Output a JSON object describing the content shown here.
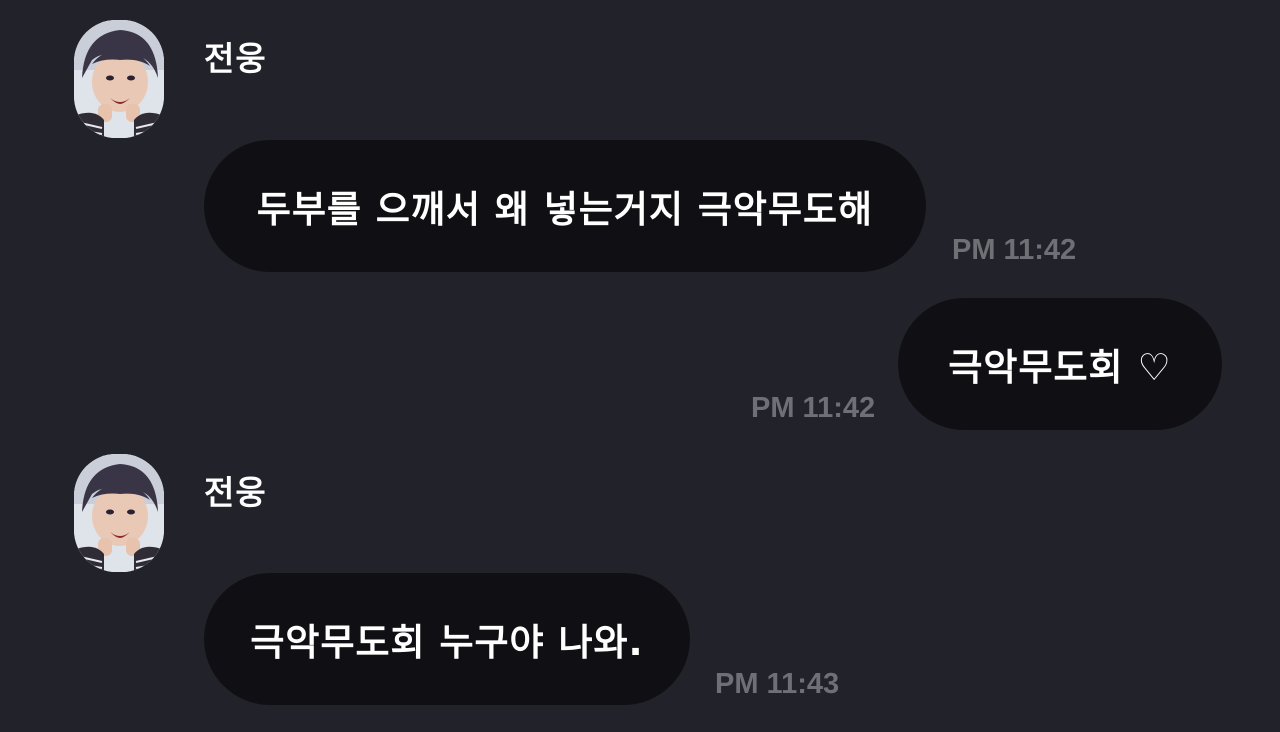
{
  "messages": [
    {
      "sender": "전웅",
      "text": "두부를 으깨서 왜 넣는거지 극악무도해",
      "time": "PM 11:42",
      "direction": "incoming",
      "avatar_icon": "profile-photo-avatar"
    },
    {
      "text": "극악무도회 ♡",
      "time": "PM 11:42",
      "direction": "outgoing"
    },
    {
      "sender": "전웅",
      "text": "극악무도회 누구야 나와.",
      "time": "PM 11:43",
      "direction": "incoming",
      "avatar_icon": "profile-photo-avatar"
    }
  ],
  "colors": {
    "background": "#22222a",
    "bubble": "#101014",
    "timestamp": "#6f6f76",
    "text": "#ffffff"
  }
}
